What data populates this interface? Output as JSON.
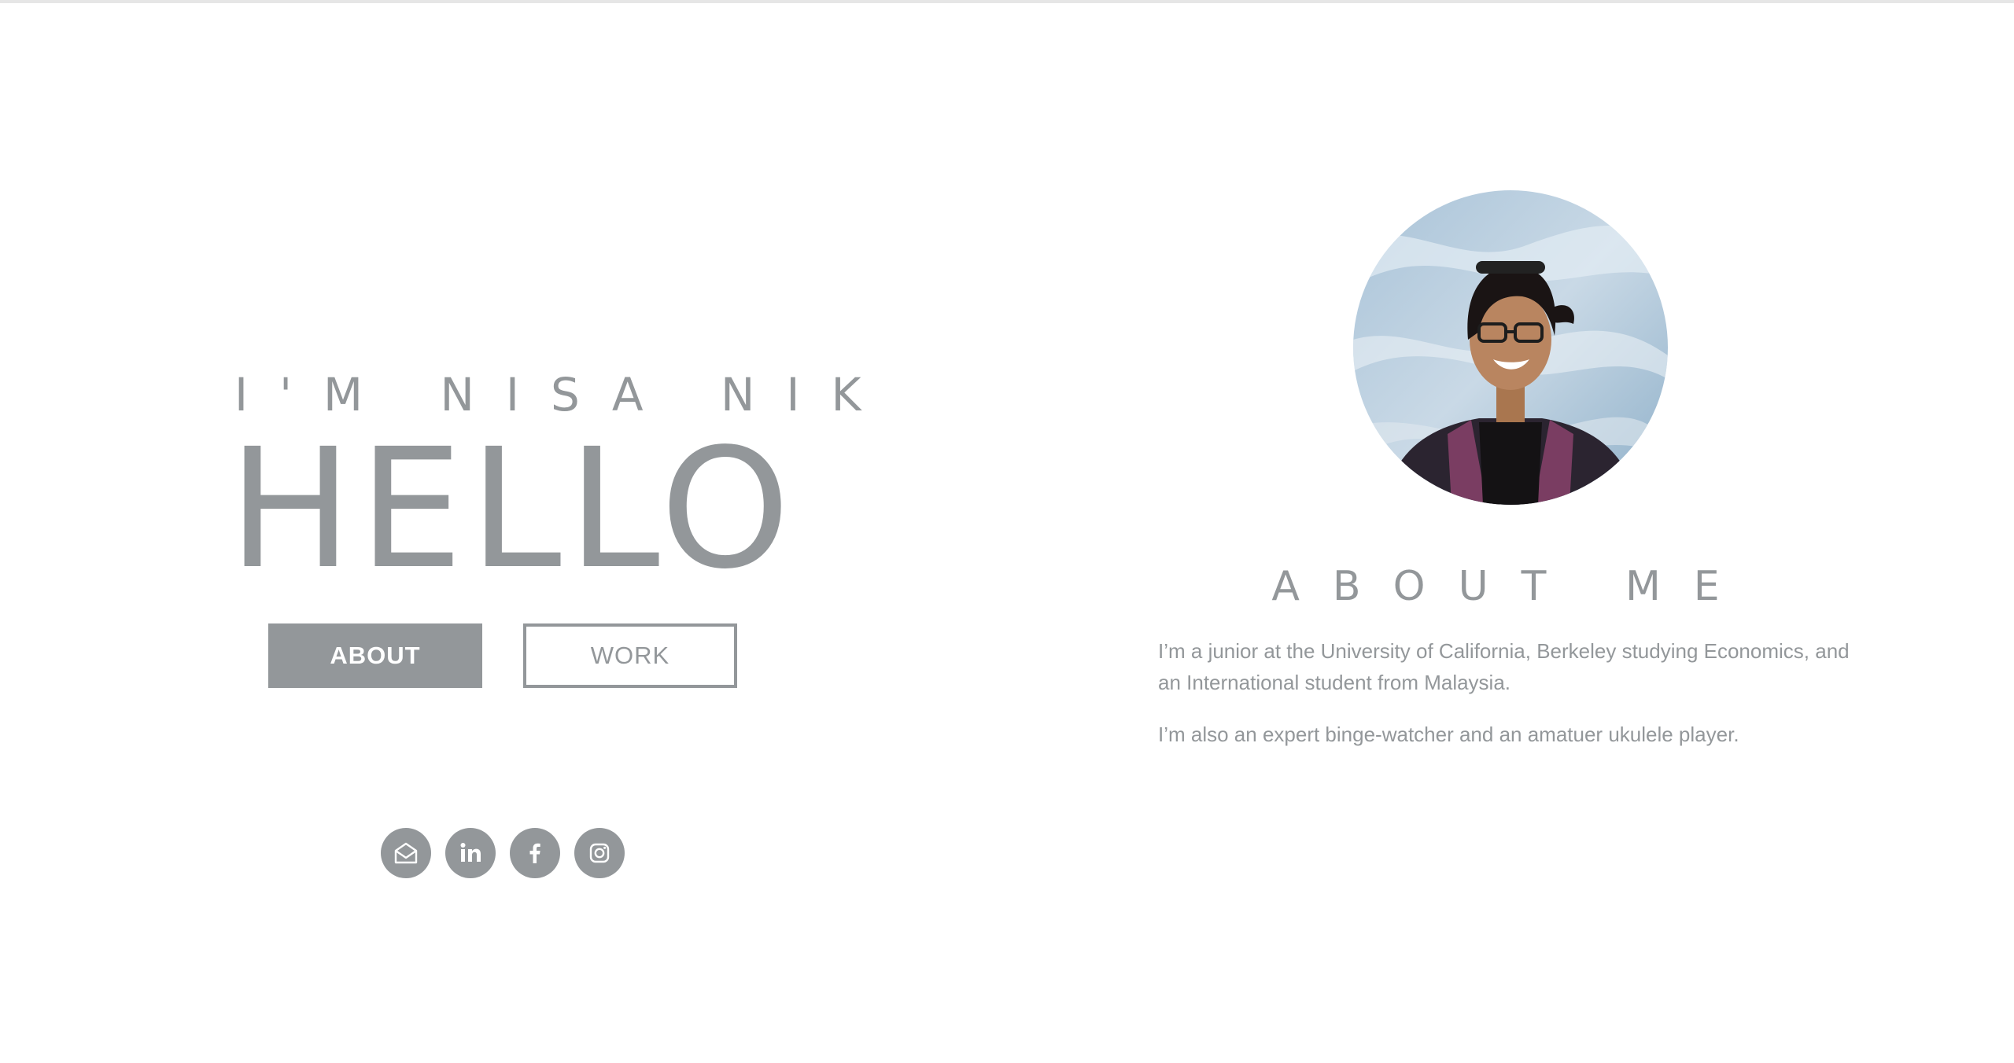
{
  "hero": {
    "intro": "I'M NISA NIK",
    "greeting": "HELLO",
    "buttons": {
      "about": "ABOUT",
      "work": "WORK"
    }
  },
  "social": {
    "items": [
      {
        "name": "email",
        "icon": "mail-icon"
      },
      {
        "name": "linkedin",
        "icon": "linkedin-icon"
      },
      {
        "name": "facebook",
        "icon": "facebook-icon"
      },
      {
        "name": "instagram",
        "icon": "instagram-icon"
      }
    ]
  },
  "about": {
    "title": "ABOUT ME",
    "paragraphs": [
      "I’m a junior at the University of California, Berkeley studying Economics, and an International student from Malaysia.",
      "I’m also an expert binge-watcher and an amatuer ukulele player."
    ]
  },
  "colors": {
    "accent": "#93979a",
    "background": "#ffffff"
  }
}
